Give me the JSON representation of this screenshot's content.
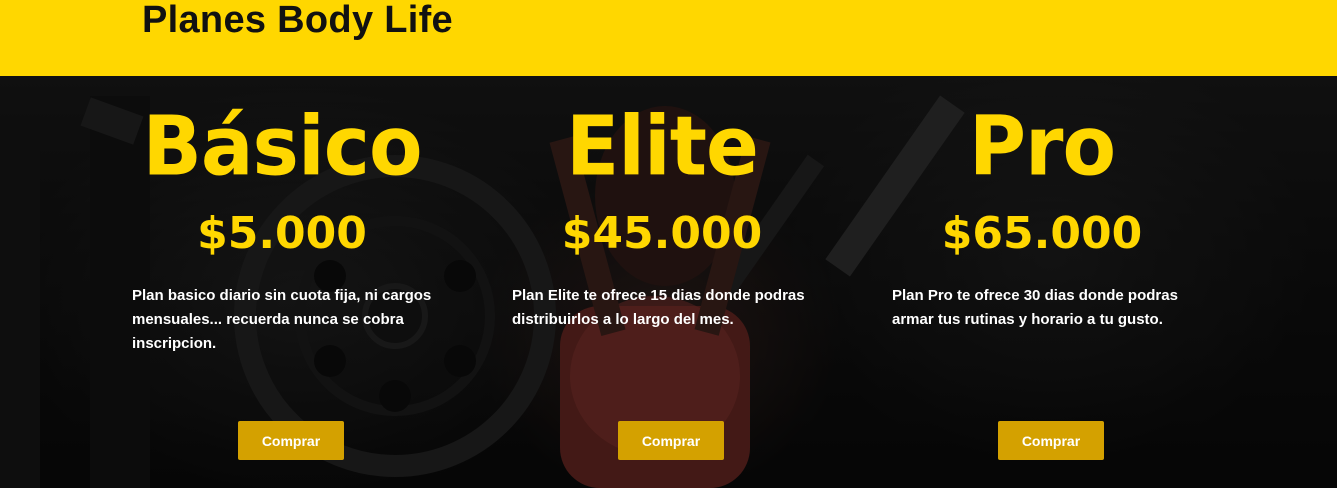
{
  "header": {
    "title": "Planes Body Life"
  },
  "colors": {
    "accent": "#ffd700",
    "button": "#d4a100",
    "text": "#ffffff"
  },
  "plans": [
    {
      "name": "Básico",
      "price": "$5.000",
      "description": "Plan basico diario sin cuota fija, ni cargos mensuales... recuerda nunca se cobra inscripcion.",
      "button_label": "Comprar"
    },
    {
      "name": "Elite",
      "price": "$45.000",
      "description": "Plan Elite te ofrece 15 dias donde podras distribuirlos a lo largo del mes.",
      "button_label": "Comprar"
    },
    {
      "name": "Pro",
      "price": "$65.000",
      "description": "Plan Pro te ofrece 30 dias donde podras armar tus rutinas y horario a tu gusto.",
      "button_label": "Comprar"
    }
  ]
}
